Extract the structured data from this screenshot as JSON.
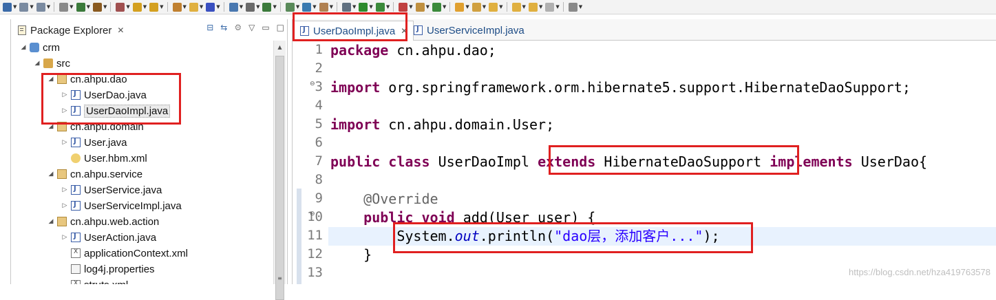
{
  "toolbar": {
    "buttons": [
      {
        "icon": "new-icon",
        "color": "#3a6aa8"
      },
      {
        "icon": "save-icon",
        "color": "#7a8aa0"
      },
      {
        "icon": "save-all-icon",
        "color": "#7a8aa0"
      },
      {
        "icon": "print-icon",
        "color": "#8a8a8a"
      },
      {
        "icon": "terminal-icon",
        "color": "#3b7a3b"
      },
      {
        "icon": "debug-icon",
        "color": "#8a5a20"
      },
      {
        "icon": "build-icon",
        "color": "#a05050"
      },
      {
        "icon": "undo-icon",
        "color": "#d4a020"
      },
      {
        "icon": "redo-icon",
        "color": "#d4a020"
      },
      {
        "icon": "package-icon",
        "color": "#c08030"
      },
      {
        "icon": "folder-icon",
        "color": "#e0b040"
      },
      {
        "icon": "cube-icon",
        "color": "#3a50c0"
      },
      {
        "icon": "search-icon",
        "color": "#4a78b0"
      },
      {
        "icon": "wand-icon",
        "color": "#6a6a6a"
      },
      {
        "icon": "new-class-icon",
        "color": "#3b7a3b"
      },
      {
        "icon": "new-file-icon",
        "color": "#5a8a5a"
      },
      {
        "icon": "globe-icon",
        "color": "#3a7ab0"
      },
      {
        "icon": "tools-icon",
        "color": "#b08050"
      },
      {
        "icon": "server-icon",
        "color": "#607080"
      },
      {
        "icon": "run-icon",
        "color": "#2e8b2e"
      },
      {
        "icon": "coverage-icon",
        "color": "#3b8a3b"
      },
      {
        "icon": "external-tools-icon",
        "color": "#c04040"
      },
      {
        "icon": "open-type-icon",
        "color": "#c09040"
      },
      {
        "icon": "refresh-icon",
        "color": "#3b8a3b"
      },
      {
        "icon": "open-folder-icon",
        "color": "#e0a030"
      },
      {
        "icon": "pen-icon",
        "color": "#d0a040"
      },
      {
        "icon": "next-annotation-icon",
        "color": "#e0b040"
      },
      {
        "icon": "previous-annotation-icon",
        "color": "#e0b040"
      },
      {
        "icon": "back-icon",
        "color": "#e0b040"
      },
      {
        "icon": "forward-icon",
        "color": "#b0b0b0"
      },
      {
        "icon": "pin-icon",
        "color": "#8a8a8a"
      }
    ]
  },
  "package_explorer": {
    "title": "Package Explorer",
    "close_glyph": "✕",
    "tree": [
      {
        "label": "crm",
        "icon": "project-icon",
        "twisty": "◢"
      },
      {
        "label": "src",
        "icon": "source-folder-icon",
        "twisty": "◢"
      },
      {
        "label": "cn.ahpu.dao",
        "icon": "package-icon",
        "twisty": "◢"
      },
      {
        "label": "UserDao.java",
        "icon": "java-file-icon",
        "twisty": "▷"
      },
      {
        "label": "UserDaoImpl.java",
        "icon": "java-file-icon",
        "twisty": "▷"
      },
      {
        "label": "cn.ahpu.domain",
        "icon": "package-icon",
        "twisty": "◢"
      },
      {
        "label": "User.java",
        "icon": "java-file-icon",
        "twisty": "▷"
      },
      {
        "label": "User.hbm.xml",
        "icon": "hbm-file-icon",
        "twisty": ""
      },
      {
        "label": "cn.ahpu.service",
        "icon": "package-icon",
        "twisty": "◢"
      },
      {
        "label": "UserService.java",
        "icon": "java-file-icon",
        "twisty": "▷"
      },
      {
        "label": "UserServiceImpl.java",
        "icon": "java-file-icon",
        "twisty": "▷"
      },
      {
        "label": "cn.ahpu.web.action",
        "icon": "package-icon",
        "twisty": "◢"
      },
      {
        "label": "UserAction.java",
        "icon": "java-file-icon",
        "twisty": "▷"
      },
      {
        "label": "applicationContext.xml",
        "icon": "xml-file-icon",
        "twisty": ""
      },
      {
        "label": "log4j.properties",
        "icon": "properties-file-icon",
        "twisty": ""
      },
      {
        "label": "struts.xml",
        "icon": "xml-file-icon",
        "twisty": ""
      }
    ]
  },
  "editor": {
    "tabs": [
      {
        "label": "UserDaoImpl.java",
        "active": true,
        "close": "✕"
      },
      {
        "label": "UserServiceImpl.java",
        "active": false
      }
    ],
    "line_numbers": [
      "1",
      "2",
      "3",
      "4",
      "5",
      "6",
      "7",
      "8",
      "9",
      "10",
      "11",
      "12",
      "13"
    ],
    "fold_markers": {
      "line3": "⊖",
      "line10": "⊖"
    },
    "code": {
      "l1": [
        [
          "kw",
          "package"
        ],
        [
          "",
          "cn.ahpu.dao;"
        ]
      ],
      "l3": [
        [
          "kw",
          "import"
        ],
        [
          "",
          "org.springframework.orm.hibernate5.support.HibernateDaoSupport;"
        ]
      ],
      "l5": [
        [
          "kw",
          "import"
        ],
        [
          "",
          "cn.ahpu.domain.User;"
        ]
      ],
      "l7a": [
        "public",
        "class",
        "UserDaoImpl"
      ],
      "l7b": [
        "extends",
        "HibernateDaoSupport"
      ],
      "l7c": [
        "implements",
        "UserDao{"
      ],
      "l9": "@Override",
      "l10a": [
        "public",
        "void"
      ],
      "l10b": "add(User user) {",
      "l11a": "System.",
      "l11b": "out",
      "l11c": ".println(",
      "l11d": "\"dao层，添加客户...\"",
      "l11e": ");",
      "l12": "}"
    }
  },
  "highlight_color": "#e02020",
  "watermark": "https://blog.csdn.net/hza419763578"
}
